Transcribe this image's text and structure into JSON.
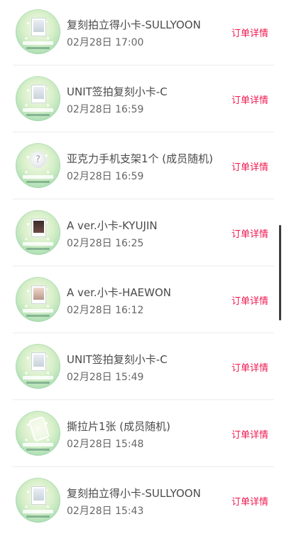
{
  "orders": [
    {
      "title": "复刻拍立得小卡-SULLYOON",
      "time": "02月28日 17:00",
      "detail_label": "订单详情",
      "thumb_icon": "polaroid-card-icon"
    },
    {
      "title": "UNIT签拍复刻小卡-C",
      "time": "02月28日 16:59",
      "detail_label": "订单详情",
      "thumb_icon": "signed-card-icon"
    },
    {
      "title": "亚克力手机支架1个 (成员随机)",
      "time": "02月28日 16:59",
      "detail_label": "订单详情",
      "thumb_icon": "phone-stand-icon"
    },
    {
      "title": "A ver.小卡-KYUJIN",
      "time": "02月28日 16:25",
      "detail_label": "订单详情",
      "thumb_icon": "photo-card-icon"
    },
    {
      "title": "A ver.小卡-HAEWON",
      "time": "02月28日 16:12",
      "detail_label": "订单详情",
      "thumb_icon": "photo-card-icon"
    },
    {
      "title": "UNIT签拍复刻小卡-C",
      "time": "02月28日 15:49",
      "detail_label": "订单详情",
      "thumb_icon": "signed-card-icon"
    },
    {
      "title": "撕拉片1张 (成员随机)",
      "time": "02月28日 15:48",
      "detail_label": "订单详情",
      "thumb_icon": "peel-film-icon"
    },
    {
      "title": "复刻拍立得小卡-SULLYOON",
      "time": "02月28日 15:43",
      "detail_label": "订单详情",
      "thumb_icon": "polaroid-card-icon"
    }
  ],
  "colors": {
    "detail_link": "#f0184f",
    "title_text": "#4a4a4a",
    "time_text": "#666666",
    "divider": "#ececec"
  }
}
